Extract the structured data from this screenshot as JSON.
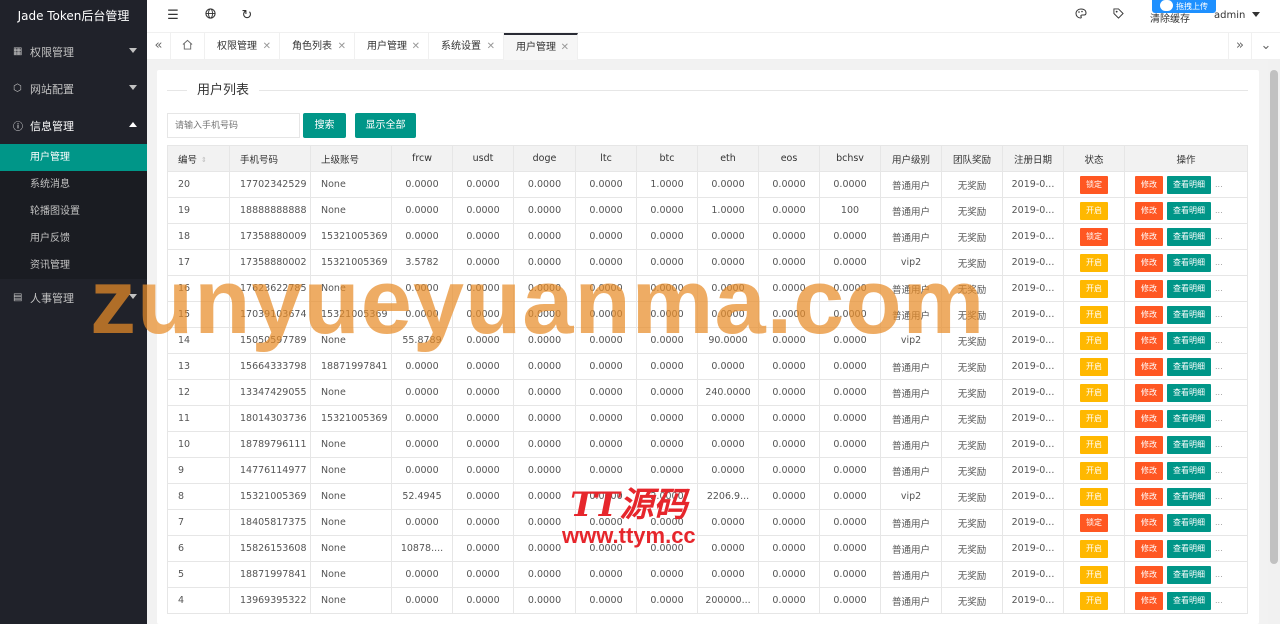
{
  "app": {
    "title": "Jade Token后台管理"
  },
  "sidebar": {
    "groups": [
      {
        "label": "权限管理",
        "icon": "grid-icon"
      },
      {
        "label": "网站配置",
        "icon": "cube-icon"
      },
      {
        "label": "信息管理",
        "icon": "info-icon"
      },
      {
        "label": "人事管理",
        "icon": "document-icon"
      }
    ],
    "sub_items": [
      "用户管理",
      "系统消息",
      "轮播图设置",
      "用户反馈",
      "资讯管理"
    ]
  },
  "header": {
    "icons": [
      "menu-toggle-icon",
      "globe-icon",
      "refresh-icon",
      "palette-icon",
      "tag-icon"
    ],
    "clear_cache": "清除缓存",
    "user": "admin",
    "upload_label": "拖拽上传"
  },
  "tabs": [
    "权限管理",
    "角色列表",
    "用户管理",
    "系统设置",
    "用户管理"
  ],
  "page": {
    "legend": "用户列表",
    "search_placeholder": "请输入手机号码",
    "search_btn": "搜索",
    "show_all_btn": "显示全部"
  },
  "table": {
    "headers": [
      "编号",
      "手机号码",
      "上级账号",
      "frcw",
      "usdt",
      "doge",
      "ltc",
      "btc",
      "eth",
      "eos",
      "bchsv",
      "用户级别",
      "团队奖励",
      "注册日期",
      "状态",
      "操作"
    ],
    "edit_label": "修改",
    "view_label": "查看明细",
    "rows": [
      [
        "20",
        "17702342529",
        "None",
        "0.0000",
        "0.0000",
        "0.0000",
        "0.0000",
        "1.0000",
        "0.0000",
        "0.0000",
        "0.0000",
        "普通用户",
        "无奖励",
        "2019-0...",
        "锁定"
      ],
      [
        "19",
        "18888888888",
        "None",
        "0.0000",
        "0.0000",
        "0.0000",
        "0.0000",
        "0.0000",
        "1.0000",
        "0.0000",
        "100",
        "普通用户",
        "无奖励",
        "2019-0...",
        "开启"
      ],
      [
        "18",
        "17358880009",
        "15321005369",
        "0.0000",
        "0.0000",
        "0.0000",
        "0.0000",
        "0.0000",
        "0.0000",
        "0.0000",
        "0.0000",
        "普通用户",
        "无奖励",
        "2019-0...",
        "锁定"
      ],
      [
        "17",
        "17358880002",
        "15321005369",
        "3.5782",
        "0.0000",
        "0.0000",
        "0.0000",
        "0.0000",
        "0.0000",
        "0.0000",
        "0.0000",
        "vip2",
        "无奖励",
        "2019-0...",
        "开启"
      ],
      [
        "16",
        "17623622785",
        "None",
        "0.0000",
        "0.0000",
        "0.0000",
        "0.0000",
        "0.0000",
        "0.0000",
        "0.0000",
        "0.0000",
        "普通用户",
        "无奖励",
        "2019-0...",
        "开启"
      ],
      [
        "15",
        "17039103674",
        "15321005369",
        "0.0000",
        "0.0000",
        "0.0000",
        "0.0000",
        "0.0000",
        "0.0000",
        "0.0000",
        "0.0000",
        "普通用户",
        "无奖励",
        "2019-0...",
        "开启"
      ],
      [
        "14",
        "15050597789",
        "None",
        "55.8789",
        "0.0000",
        "0.0000",
        "0.0000",
        "0.0000",
        "90.0000",
        "0.0000",
        "0.0000",
        "vip2",
        "无奖励",
        "2019-0...",
        "开启"
      ],
      [
        "13",
        "15664333798",
        "18871997841",
        "0.0000",
        "0.0000",
        "0.0000",
        "0.0000",
        "0.0000",
        "0.0000",
        "0.0000",
        "0.0000",
        "普通用户",
        "无奖励",
        "2019-0...",
        "开启"
      ],
      [
        "12",
        "13347429055",
        "None",
        "0.0000",
        "0.0000",
        "0.0000",
        "0.0000",
        "0.0000",
        "240.0000",
        "0.0000",
        "0.0000",
        "普通用户",
        "无奖励",
        "2019-0...",
        "开启"
      ],
      [
        "11",
        "18014303736",
        "15321005369",
        "0.0000",
        "0.0000",
        "0.0000",
        "0.0000",
        "0.0000",
        "0.0000",
        "0.0000",
        "0.0000",
        "普通用户",
        "无奖励",
        "2019-0...",
        "开启"
      ],
      [
        "10",
        "18789796111",
        "None",
        "0.0000",
        "0.0000",
        "0.0000",
        "0.0000",
        "0.0000",
        "0.0000",
        "0.0000",
        "0.0000",
        "普通用户",
        "无奖励",
        "2019-0...",
        "开启"
      ],
      [
        "9",
        "14776114977",
        "None",
        "0.0000",
        "0.0000",
        "0.0000",
        "0.0000",
        "0.0000",
        "0.0000",
        "0.0000",
        "0.0000",
        "普通用户",
        "无奖励",
        "2019-0...",
        "开启"
      ],
      [
        "8",
        "15321005369",
        "None",
        "52.4945",
        "0.0000",
        "0.0000",
        "0.0000",
        "2.0000",
        "2206.9...",
        "0.0000",
        "0.0000",
        "vip2",
        "无奖励",
        "2019-0...",
        "开启"
      ],
      [
        "7",
        "18405817375",
        "None",
        "0.0000",
        "0.0000",
        "0.0000",
        "0.0000",
        "0.0000",
        "0.0000",
        "0.0000",
        "0.0000",
        "普通用户",
        "无奖励",
        "2019-0...",
        "锁定"
      ],
      [
        "6",
        "15826153608",
        "None",
        "10878....",
        "0.0000",
        "0.0000",
        "0.0000",
        "0.0000",
        "0.0000",
        "0.0000",
        "0.0000",
        "普通用户",
        "无奖励",
        "2019-0...",
        "开启"
      ],
      [
        "5",
        "18871997841",
        "None",
        "0.0000",
        "0.0000",
        "0.0000",
        "0.0000",
        "0.0000",
        "0.0000",
        "0.0000",
        "0.0000",
        "普通用户",
        "无奖励",
        "2019-0...",
        "开启"
      ],
      [
        "4",
        "13969395322",
        "None",
        "0.0000",
        "0.0000",
        "0.0000",
        "0.0000",
        "0.0000",
        "200000...",
        "0.0000",
        "0.0000",
        "普通用户",
        "无奖励",
        "2019-0...",
        "开启"
      ]
    ]
  },
  "watermarks": {
    "main": "zunyueyuanma.com",
    "brand": "TT源码",
    "brand_url": "www.ttym.cc"
  },
  "colors": {
    "accent": "#009688",
    "sidebar_bg": "#20222a",
    "status_open": "#ffb800",
    "status_lock": "#ff5722"
  }
}
